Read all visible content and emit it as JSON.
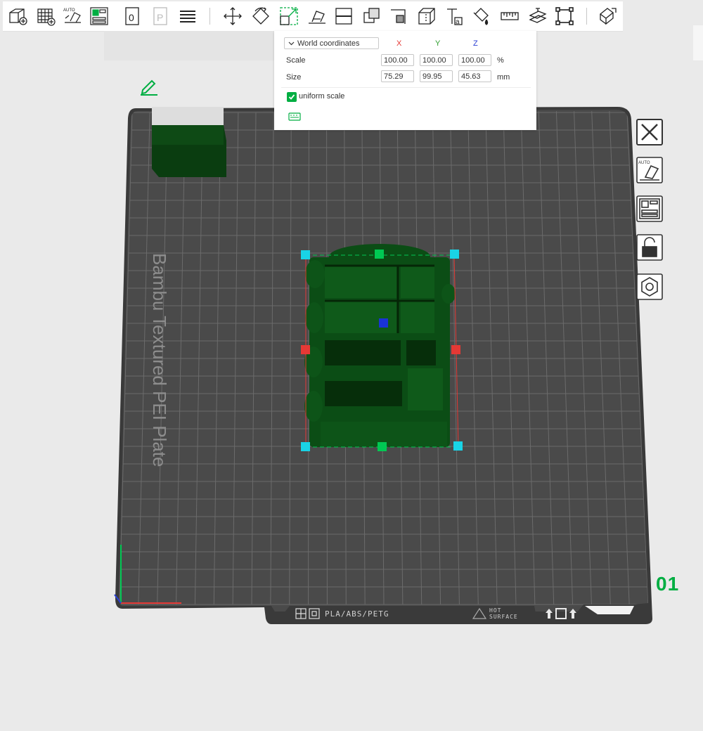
{
  "toolbar": {
    "icons": [
      "add-cube-icon",
      "add-plate-icon",
      "auto-arrange-icon",
      "arrange-icon",
      "orient-icon",
      "plate-icon",
      "layers-icon",
      "move-icon",
      "rotate-icon",
      "scale-icon",
      "lay-on-face-icon",
      "cut-icon",
      "boolean-icon",
      "support-paint-icon",
      "seam-icon",
      "text-icon",
      "paint-icon",
      "measure-icon",
      "assembly-icon",
      "split-icon",
      "view-icon"
    ]
  },
  "scale_panel": {
    "coordinate_mode": "World coordinates",
    "axes": {
      "x": "X",
      "y": "Y",
      "z": "Z"
    },
    "axis_colors": {
      "x": "#e53935",
      "y": "#2e9e2e",
      "z": "#2a3fd4"
    },
    "scale": {
      "label": "Scale",
      "x": "100.00",
      "y": "100.00",
      "z": "100.00",
      "unit": "%"
    },
    "size": {
      "label": "Size",
      "x": "75.29",
      "y": "99.95",
      "z": "45.63",
      "unit": "mm"
    },
    "uniform_scale": {
      "label": "uniform scale",
      "checked": true
    }
  },
  "plate": {
    "name_text": "Bambu Textured PEI Plate",
    "number": "01",
    "filament_tag": "PLA/ABS/PETG",
    "hot_surface": "HOT\nSURFACE",
    "accent": "#00ae42",
    "bed_color": "#4a4a4a",
    "grid_color": "#6b6b6b",
    "model_color": "#0b4d15"
  },
  "side_toolbar": {
    "icons": [
      "close-icon",
      "auto-orient-icon",
      "arrange-plate-icon",
      "lock-icon",
      "settings-icon"
    ]
  }
}
